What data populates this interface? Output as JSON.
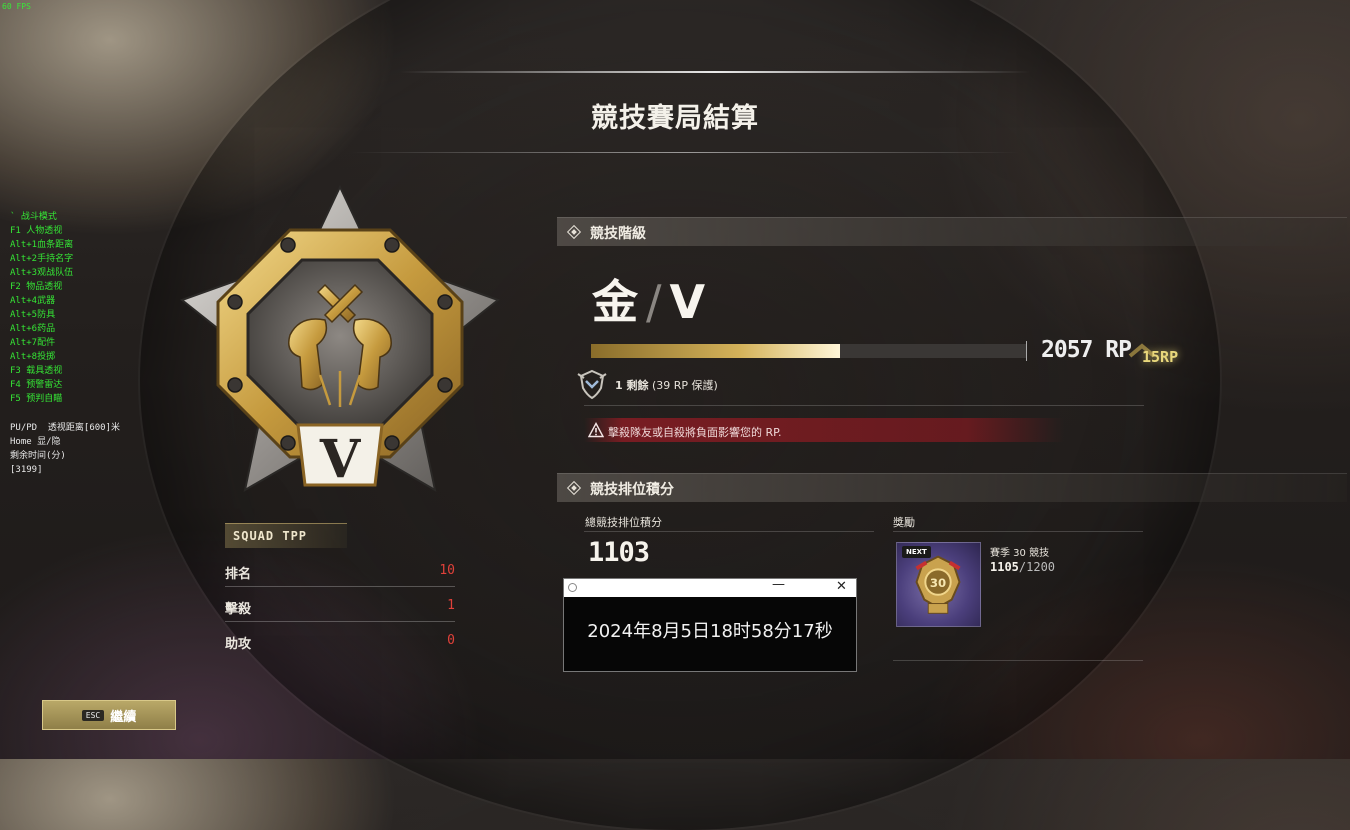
{
  "fps_counter": "60 FPS",
  "page_title": "競技賽局結算",
  "cheat_menu": [
    "` 战斗模式",
    "F1 人物透视",
    "Alt+1血条距离",
    "Alt+2手持名字",
    "Alt+3观战队伍",
    "F2 物品透视",
    "Alt+4武器",
    "Alt+5防具",
    "Alt+6药品",
    "Alt+7配件",
    "Alt+8投掷",
    "F3 载具透视",
    "F4 预警雷达",
    "F5 预判自瞄"
  ],
  "cheat_info": [
    "PU/PD  透视距离[600]米",
    "Home 显/隐",
    "剩余时间(分)",
    "[3199]"
  ],
  "emblem": {
    "tier_numeral": "V",
    "icon": "crossed-revolvers-emblem"
  },
  "mode": {
    "label": "SQUAD TPP",
    "stats": [
      {
        "label": "排名",
        "value": "10"
      },
      {
        "label": "擊殺",
        "value": "1"
      },
      {
        "label": "助攻",
        "value": "0"
      }
    ]
  },
  "continue_button": {
    "key": "ESC",
    "label": "繼續"
  },
  "ranked_tier": {
    "header": "競技階級",
    "tier": "金",
    "slash": "/",
    "division": "V",
    "progress_fraction": 0.57,
    "rp_value": "2057 RP",
    "rp_gain": "15RP",
    "protection_count": "1 剩餘",
    "protection_note": "(39 RP 保護)",
    "warning": "擊殺隊友或自殺將負面影響您的 RP."
  },
  "ranked_points": {
    "header": "競技排位積分",
    "total_label": "總競技排位積分",
    "total_value": "1103",
    "rewards_label": "獎勵",
    "reward": {
      "tag": "NEXT",
      "name": "賽季 30 競技",
      "current": "1105",
      "target": "/1200"
    }
  },
  "clock_window": {
    "datetime": "2024年8月5日18时58分17秒",
    "min_glyph": "—",
    "close_glyph": "✕"
  },
  "colors": {
    "gold": "#d4b25a",
    "stat_value": "#e0413a",
    "warning_bg": "#87232a",
    "cheat_text": "#35e435"
  }
}
